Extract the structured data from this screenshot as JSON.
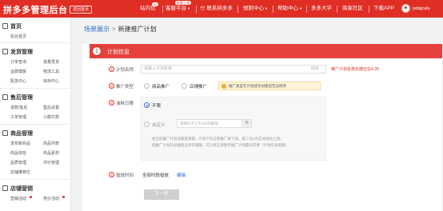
{
  "header": {
    "logo": "拼多多管理后台",
    "back_home": "返回首页",
    "nav": [
      {
        "label": "站内信",
        "badge": "26"
      },
      {
        "label": "客服平台",
        "badge": "新版上线"
      },
      {
        "label": "联系拼多多"
      },
      {
        "label": "规则中心"
      },
      {
        "label": "帮助中心"
      },
      {
        "label": "多多大学"
      },
      {
        "label": "商家社区"
      },
      {
        "label": "下载APP"
      }
    ],
    "username": "pddgrafu"
  },
  "sidebar": {
    "home": {
      "label": "首页",
      "items": [
        "后台首页"
      ]
    },
    "sections": [
      {
        "label": "发货管理",
        "items": [
          "订单查询",
          "批量发货",
          "运费模板",
          "物流工具",
          "配货中心",
          "库存中心"
        ]
      },
      {
        "label": "售后管理",
        "items": [
          "退款/售后",
          "售后设置",
          "工单管理",
          "小额打款"
        ]
      },
      {
        "label": "商品管理",
        "items": [
          "发布新商品",
          "商品列表",
          "商品体检",
          "商品素材",
          "品质管理",
          "评价管理",
          "店铺推荐位"
        ]
      },
      {
        "label": "店铺营销",
        "items": [
          "营销活动",
          "竞价活动"
        ]
      }
    ]
  },
  "breadcrumb": {
    "parent": "场景展示",
    "separator": ">",
    "current": "新建推广计划"
  },
  "card": {
    "step": "1",
    "title": "计划信息",
    "rows": [
      {
        "num": "1",
        "label": "计划名称",
        "placeholder": "请输入计划名称",
        "counter": "0/20",
        "hint": "推广计划名称长度应在4-20"
      },
      {
        "num": "2",
        "label": "推广类型",
        "options": [
          "商品推广",
          "店铺推广"
        ],
        "notice": "推广类型在计划成功创建后无法修改"
      },
      {
        "num": "3",
        "label": "油耗日限",
        "options": [
          "不限",
          "自定义"
        ],
        "budget_placeholder": "请填写不小于100的数值",
        "unit": "元",
        "desc": [
          "给当前推广计划总额度限额，计划下的全部推广将下线，第二天0点自动调动上线；",
          "如推广计划日总额超过单日限额，可以修正调整单推广计划最高花费（计划日总限额）"
        ]
      },
      {
        "num": "4",
        "label": "投放时间",
        "value": "全部时段投放",
        "edit": "编辑"
      }
    ],
    "next_button": "下一步"
  },
  "colors": {
    "brand": "#e02e24",
    "link": "#2d6ac8"
  }
}
